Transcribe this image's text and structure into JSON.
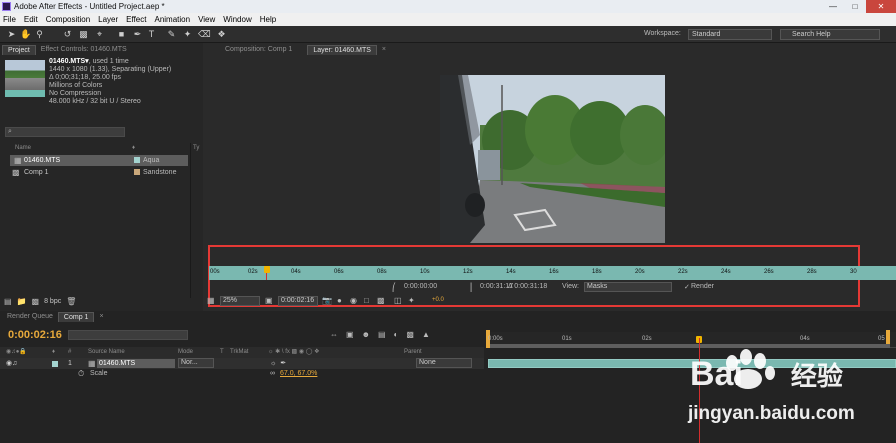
{
  "window": {
    "title": "Adobe After Effects - Untitled Project.aep *"
  },
  "menu": [
    "File",
    "Edit",
    "Composition",
    "Layer",
    "Effect",
    "Animation",
    "View",
    "Window",
    "Help"
  ],
  "toolbar": {
    "workspace_label": "Workspace:",
    "workspace_value": "Standard",
    "search_placeholder": "Search Help"
  },
  "project_panel": {
    "tabs": [
      "Project",
      "Effect Controls: 01460.MTS"
    ],
    "file_name": "01460.MTS▾",
    "file_usage": ", used 1 time",
    "info_lines": [
      "1440 x 1080 (1.33), Separating (Upper)",
      "Δ 0;00;31;18, 25.00 fps",
      "Millions of Colors",
      "No Compression",
      "48.000 kHz / 32 bit U / Stereo"
    ],
    "search_icon": "⌕",
    "col_name": "Name",
    "col_type": "Ty",
    "items": [
      {
        "name": "01460.MTS",
        "label": "Aqua",
        "color": "#a3d3cf"
      },
      {
        "name": "Comp 1",
        "label": "Sandstone",
        "color": "#c9a77a"
      }
    ],
    "bpc": "8 bpc"
  },
  "viewer": {
    "tabs": [
      "Composition: Comp 1",
      "Layer: 01460.MTS"
    ],
    "ruler_ticks": [
      "00s",
      "02s",
      "04s",
      "06s",
      "08s",
      "10s",
      "12s",
      "14s",
      "16s",
      "18s",
      "20s",
      "22s",
      "24s",
      "26s",
      "28s",
      "30"
    ],
    "in_time": "0:00:00:00",
    "out_time": "0:00:31:17",
    "duration": "Δ 0:00:31:18",
    "view_label": "View:",
    "view_value": "Masks",
    "render_label": "Render",
    "render_check": "✓",
    "zoom": "25%",
    "current_time": "0:00:02:16",
    "offset": "+0.0"
  },
  "timeline": {
    "tabs": [
      "Render Queue",
      "Comp 1"
    ],
    "timecode": "0:00:02:16",
    "col_headers": {
      "source": "Source Name",
      "mode": "Mode",
      "t": "T",
      "trkmat": "TrkMat",
      "parent": "Parent"
    },
    "layer": {
      "number": "1",
      "name": "01460.MTS",
      "mode": "Nor...",
      "parent": "None"
    },
    "scale": {
      "name": "Scale",
      "value": "67.0, 67.0%"
    },
    "ruler_ticks": [
      "0:00s",
      "01s",
      "02s",
      "04s",
      "05"
    ]
  },
  "watermark": {
    "text": "Bai",
    "text2": "经验",
    "url": "jingyan.baidu.com"
  }
}
